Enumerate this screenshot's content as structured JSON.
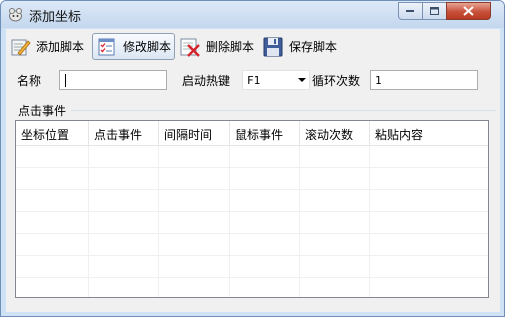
{
  "window": {
    "title": "添加坐标"
  },
  "toolbar": {
    "add_label": "添加脚本",
    "edit_label": "修改脚本",
    "delete_label": "删除脚本",
    "save_label": "保存脚本"
  },
  "form": {
    "name_label": "名称",
    "name_value": "",
    "hotkey_label": "启动热键",
    "hotkey_value": "F1",
    "loop_label": "循环次数",
    "loop_value": "1"
  },
  "events": {
    "group_label": "点击事件",
    "columns": [
      "坐标位置",
      "点击事件",
      "间隔时间",
      "鼠标事件",
      "滚动次数",
      "粘贴内容"
    ]
  }
}
